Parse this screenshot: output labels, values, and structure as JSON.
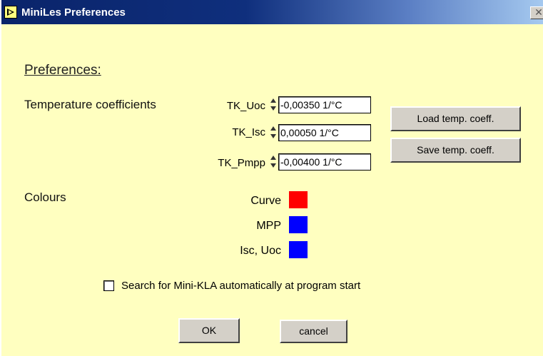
{
  "window": {
    "title": "MiniLes Preferences",
    "close_glyph": "✕"
  },
  "heading": "Preferences:",
  "temperature": {
    "section_label": "Temperature coefficients",
    "rows": [
      {
        "label": "TK_Uoc",
        "value": "-0,00350  1/°C"
      },
      {
        "label": "TK_Isc",
        "value": "0,00050  1/°C"
      },
      {
        "label": "TK_Pmpp",
        "value": "-0,00400  1/°C"
      }
    ],
    "load_button": "Load temp. coeff.",
    "save_button": "Save temp. coeff."
  },
  "colours": {
    "section_label": "Colours",
    "items": [
      {
        "label": "Curve",
        "color": "#ff0000"
      },
      {
        "label": "MPP",
        "color": "#0000ff"
      },
      {
        "label": "Isc, Uoc",
        "color": "#0000ff"
      }
    ]
  },
  "search_checkbox": {
    "label": "Search for Mini-KLA automatically at program start",
    "checked": false
  },
  "buttons": {
    "ok": "OK",
    "cancel": "cancel"
  }
}
